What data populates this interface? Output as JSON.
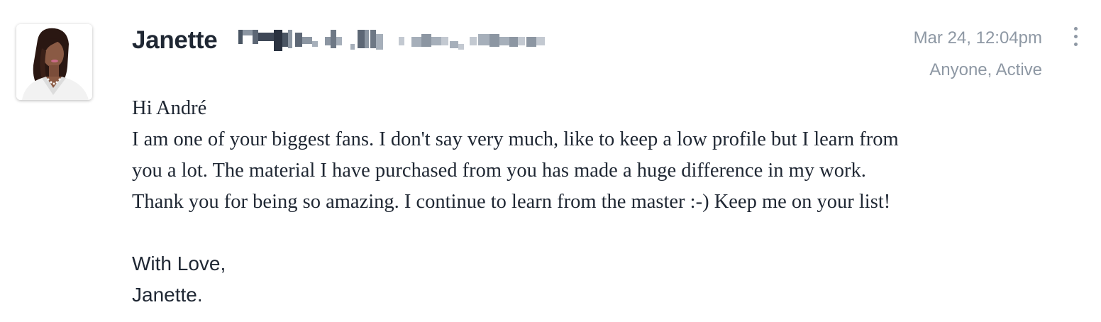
{
  "post": {
    "author_name": "Janette",
    "timestamp": "Mar 24, 12:04pm",
    "visibility": "Anyone, Active",
    "more_icon": "more-vertical-icon",
    "avatar_icon": "avatar-photo",
    "message_lines": [
      "Hi André",
      "I am one of your biggest fans. I don't say very much, like to keep a low profile but I learn from",
      "you a lot. The material I have purchased from you has made a huge difference in my work.",
      "Thank you for being so amazing. I continue to learn from the master :-) Keep me on your list!"
    ],
    "signoff_lines": [
      "With Love,",
      "Janette."
    ]
  },
  "colors": {
    "text": "#1f2733",
    "muted": "#8e98a4"
  }
}
